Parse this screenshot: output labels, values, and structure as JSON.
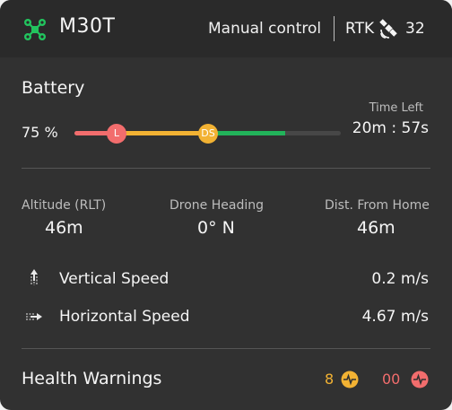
{
  "header": {
    "drone_name": "M30T",
    "mode": "Manual control",
    "rtk_label": "RTK",
    "satellite_count": "32",
    "accent_color": "#22c55e"
  },
  "battery": {
    "title": "Battery",
    "percent_text": "75 %",
    "level_percent": 75,
    "low_marker_label": "L",
    "ds_marker_label": "DS",
    "time_left_label": "Time Left",
    "time_left_value": "20m : 57s",
    "colors": {
      "critical": "#f26d6d",
      "warning": "#f2b233",
      "ok": "#22b35a",
      "track": "#474747"
    }
  },
  "stats": [
    {
      "label": "Altitude (RLT)",
      "value": "46m"
    },
    {
      "label": "Drone Heading",
      "value": "0° N"
    },
    {
      "label": "Dist. From Home",
      "value": "46m"
    }
  ],
  "speeds": {
    "vertical": {
      "label": "Vertical Speed",
      "value": "0.2 m/s",
      "icon": "vertical-speed-icon"
    },
    "horizontal": {
      "label": "Horizontal Speed",
      "value": "4.67 m/s",
      "icon": "horizontal-speed-icon"
    }
  },
  "health": {
    "title": "Health Warnings",
    "warning_count": "8",
    "error_count": "00",
    "warning_color": "#f2b233",
    "error_color": "#f26d6d"
  }
}
